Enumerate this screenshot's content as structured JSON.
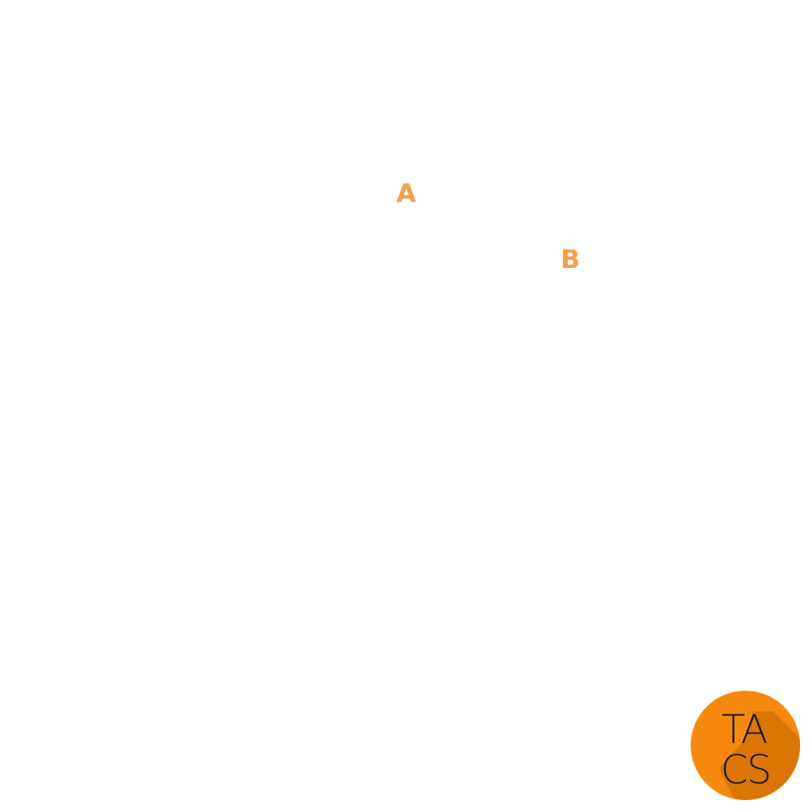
{
  "labels": {
    "a": "A",
    "b": "B"
  },
  "logo": {
    "text_line1": "TA",
    "text_line2": "CS",
    "circle_color": "#f68a0f",
    "shadow_color": "#d97506",
    "text_color": "#1a1a1a"
  },
  "colors": {
    "label": "#f5a04a",
    "background": "#ffffff"
  }
}
